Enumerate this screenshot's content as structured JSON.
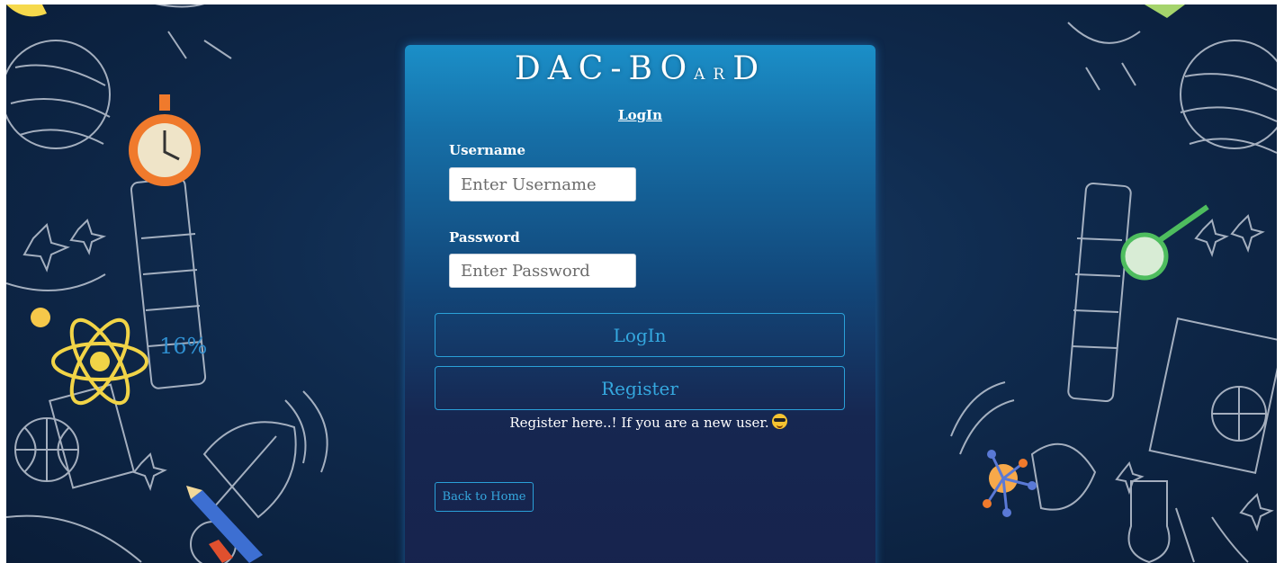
{
  "brand": {
    "part1": "DAC-BO",
    "part2": "AR",
    "part3": "D"
  },
  "form": {
    "title_link": "LogIn",
    "username_label": "Username",
    "username_placeholder": "Enter Username",
    "password_label": "Password",
    "password_placeholder": "Enter Password",
    "login_button": "LogIn",
    "register_button": "Register",
    "register_hint": "Register here..! If you are a new user.",
    "back_button": "Back to Home"
  },
  "background": {
    "doodle_text": "16%"
  },
  "colors": {
    "background": "#0f2a4d",
    "card_top": "#1b8fc8",
    "card_bottom": "#17234d",
    "button_outline": "#2aa0d8",
    "button_text": "#35a8df"
  },
  "icons": [
    "sunglasses-emoji-icon"
  ]
}
